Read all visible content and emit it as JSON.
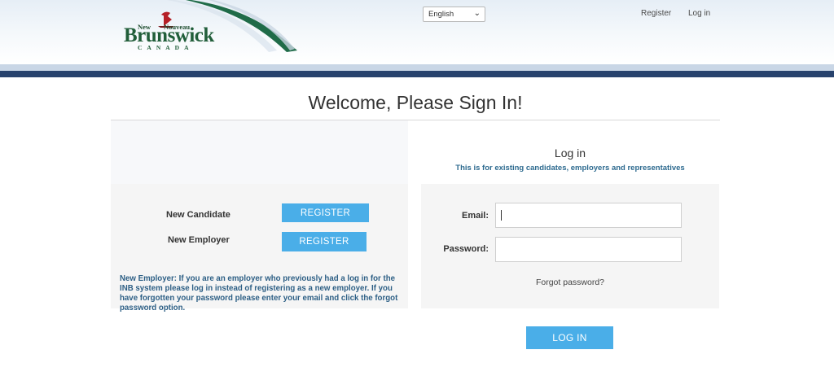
{
  "header": {
    "logo": {
      "new": "New",
      "nouveau": "Nouveau",
      "main": "Brunswick",
      "country": "CANADA"
    },
    "language": {
      "selected": "English"
    },
    "links": {
      "register": "Register",
      "login": "Log in"
    }
  },
  "page": {
    "title": "Welcome, Please Sign In!"
  },
  "register_panel": {
    "candidate_label": "New Candidate",
    "candidate_button": "REGISTER",
    "employer_label": "New Employer",
    "employer_button": "REGISTER",
    "note": "New Employer: If you are an employer who previously had a log in for the INB system please log in instead of registering as a new employer. If you have forgotten your password please enter your email and click the forgot password option."
  },
  "login_panel": {
    "heading": "Log in",
    "subtitle": "This is for existing candidates, employers and representatives",
    "email_label": "Email:",
    "email_value": "",
    "password_label": "Password:",
    "password_value": "",
    "forgot_link": "Forgot password?",
    "login_button": "LOG IN"
  },
  "colors": {
    "accent_button": "#4aaee8",
    "header_band": "#27426d",
    "note_text": "#2d5f85",
    "logo_green": "#215e3a"
  }
}
